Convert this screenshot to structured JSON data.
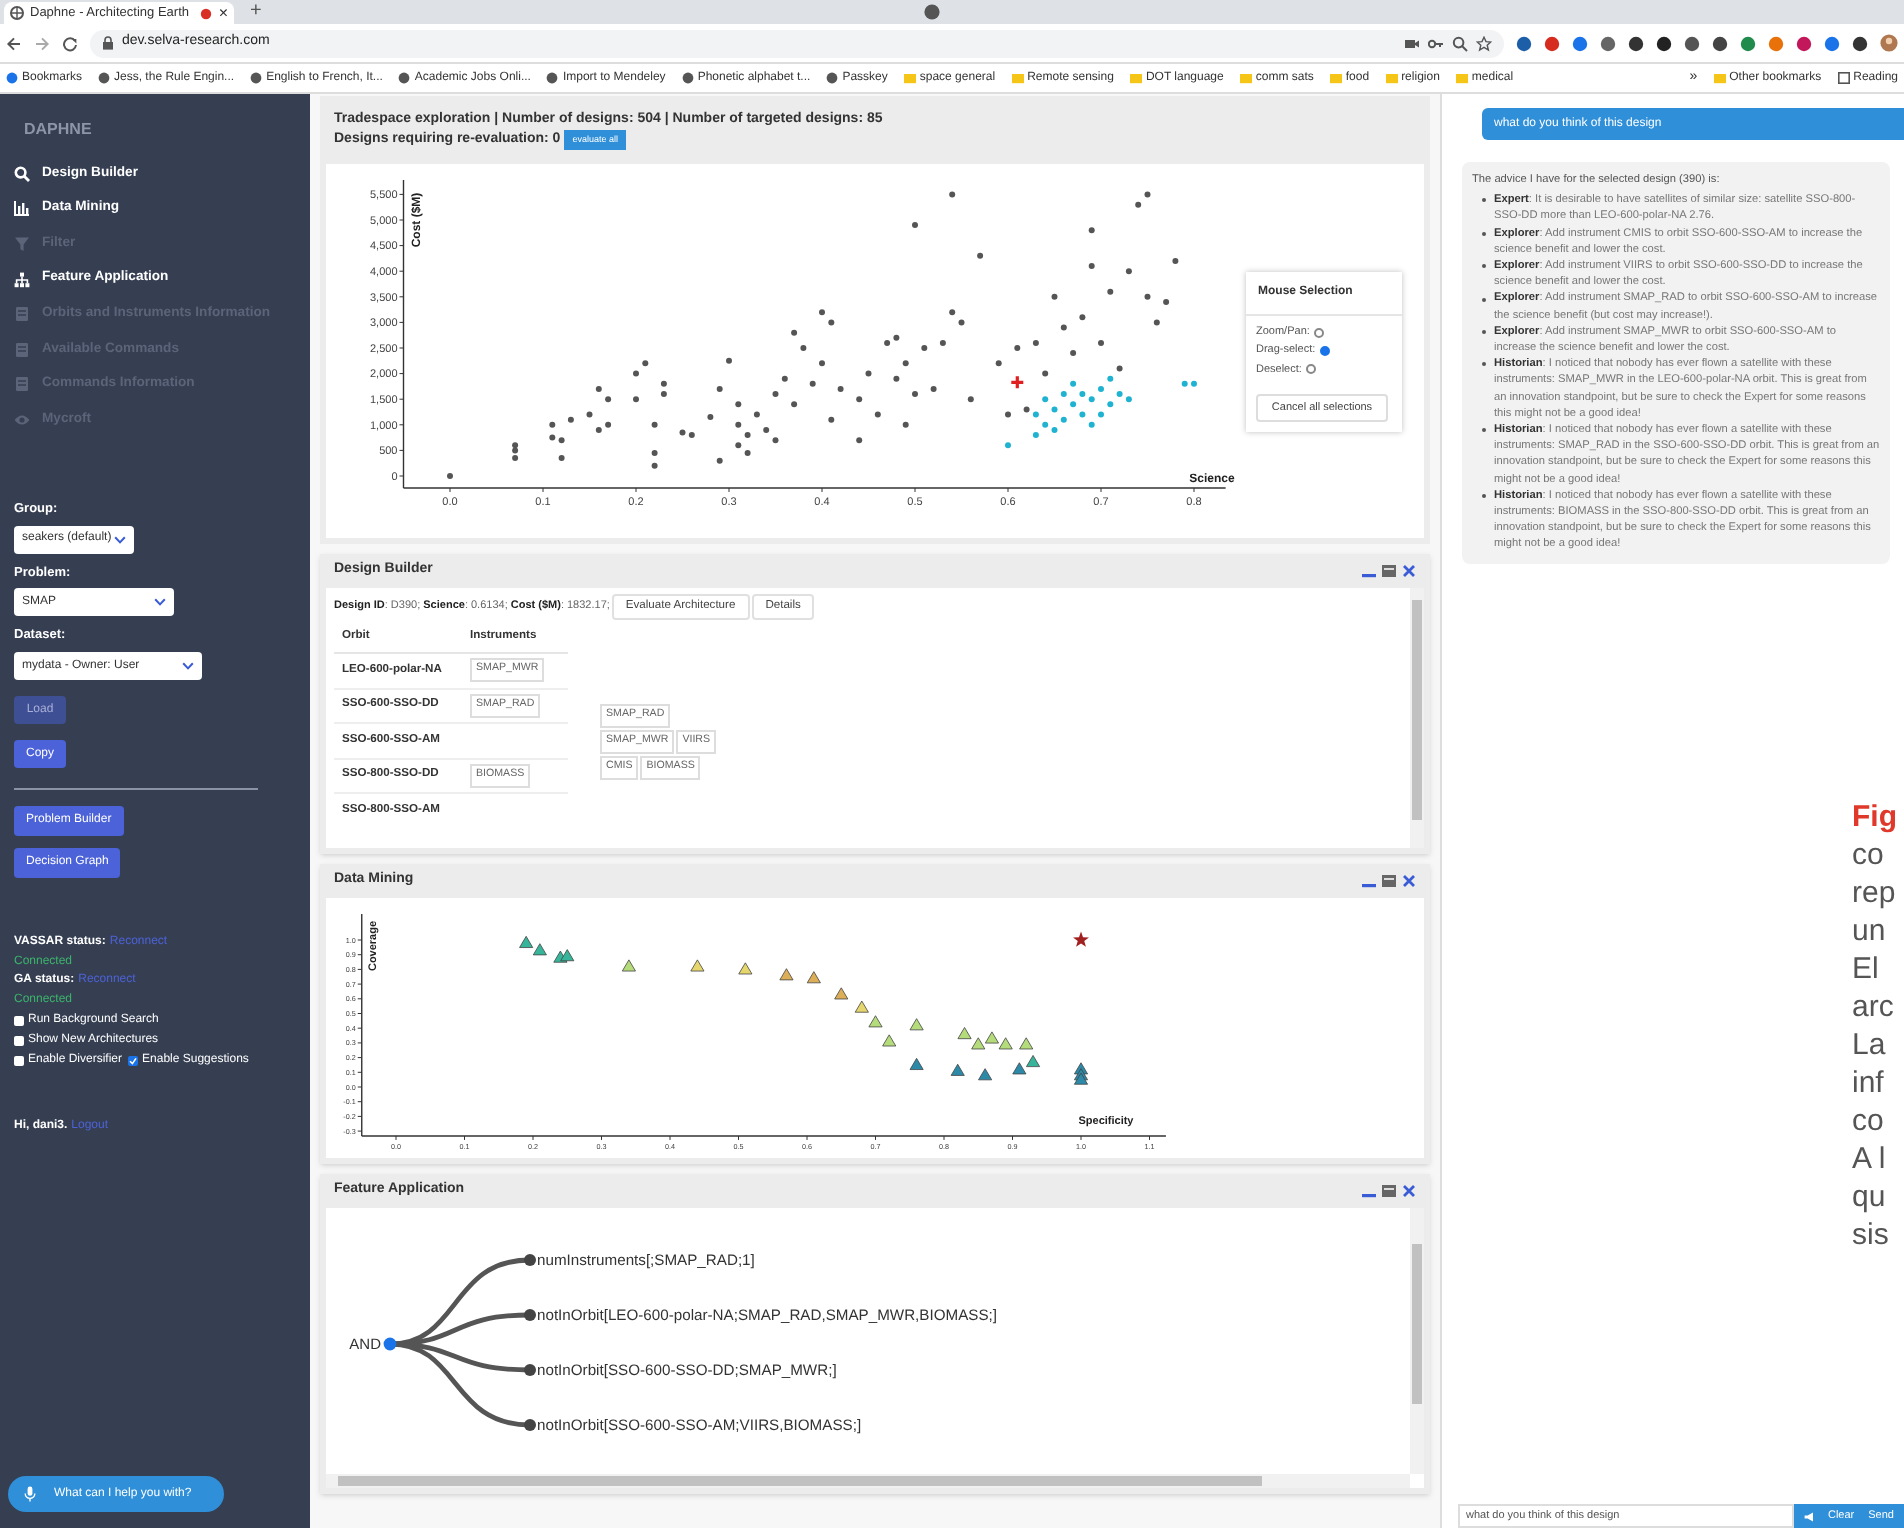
{
  "browser": {
    "tab": {
      "title": "Daphne - Architecting Earth",
      "recording": true,
      "close": "×"
    },
    "new_tab": "+",
    "address": "dev.selva-research.com",
    "bookmarks": [
      "Bookmarks",
      "Jess, the Rule Engin...",
      "English to French, It...",
      "Academic Jobs Onli...",
      "Import to Mendeley",
      "Phonetic alphabet t...",
      "Passkey",
      "space general",
      "Remote sensing",
      "DOT language",
      "comm sats",
      "food",
      "religion",
      "medical"
    ],
    "more": "»",
    "other_bookmarks": [
      "Other bookmarks",
      "Reading"
    ]
  },
  "sidebar": {
    "logo": "DAPHNE",
    "nav": [
      {
        "label": "Design Builder",
        "disabled": false
      },
      {
        "label": "Data Mining",
        "disabled": false
      },
      {
        "label": "Filter",
        "disabled": true
      },
      {
        "label": "Feature Application",
        "disabled": false
      },
      {
        "label": "Orbits and Instruments Information",
        "disabled": true
      },
      {
        "label": "Available Commands",
        "disabled": true
      },
      {
        "label": "Commands Information",
        "disabled": true
      },
      {
        "label": "Mycroft",
        "disabled": true
      }
    ],
    "selects": [
      {
        "label": "Group:",
        "value": "seakers (default)"
      },
      {
        "label": "Problem:",
        "value": "SMAP"
      },
      {
        "label": "Dataset:",
        "value": "mydata - Owner: User"
      }
    ],
    "buttons": [
      {
        "label": "Load",
        "disabled": true
      },
      {
        "label": "Copy",
        "disabled": false
      }
    ],
    "buttons_2": [
      "Problem Builder",
      "Decision Graph"
    ],
    "status": [
      {
        "label": "VASSAR status:",
        "action": "Reconnect",
        "state": "Connected"
      },
      {
        "label": "GA status:",
        "action": "Reconnect",
        "state": "Connected"
      }
    ],
    "options": [
      [
        {
          "label": "Run Background Search",
          "checked": false
        }
      ],
      [
        {
          "label": "Show New Architectures",
          "checked": false
        }
      ],
      [
        {
          "label": "Enable Diversifier",
          "checked": false
        },
        {
          "label": "Enable Suggestions",
          "checked": true
        }
      ]
    ],
    "greeting": "Hi, dani3.",
    "logout": "Logout",
    "assistant_button": "What can I help you with?"
  },
  "tradespace": {
    "title": "Tradespace exploration | Number of designs: 504 | Number of targeted designs: 85",
    "reevaluation": "Designs requiring re-evaluation: 0",
    "evaluate_button": "evaluate all",
    "chart_data": {
      "type": "scatter",
      "xlabel": "Science",
      "ylabel": "Cost ($M)",
      "xticks": [
        {
          "value": 0,
          "label": "0.0"
        },
        {
          "value": 0.1,
          "label": "0.1"
        },
        {
          "value": 0.2,
          "label": "0.2"
        },
        {
          "value": 0.3,
          "label": "0.3"
        },
        {
          "value": 0.4,
          "label": "0.4"
        },
        {
          "value": 0.5,
          "label": "0.5"
        },
        {
          "value": 0.6,
          "label": "0.6"
        },
        {
          "value": 0.7,
          "label": "0.7"
        },
        {
          "value": 0.8,
          "label": "0.8"
        }
      ],
      "yticks": [
        {
          "value": 0,
          "label": "0"
        },
        {
          "value": 500,
          "label": "500"
        },
        {
          "value": 1000,
          "label": "1,000"
        },
        {
          "value": 1500,
          "label": "1,500"
        },
        {
          "value": 2000,
          "label": "2,000"
        },
        {
          "value": 2500,
          "label": "2,500"
        },
        {
          "value": 3000,
          "label": "3,000"
        },
        {
          "value": 3500,
          "label": "3,500"
        },
        {
          "value": 4000,
          "label": "4,000"
        },
        {
          "value": 4500,
          "label": "4,500"
        },
        {
          "value": 5000,
          "label": "5,000"
        },
        {
          "value": 5500,
          "label": "5,500"
        }
      ],
      "xlim": [
        -0.05,
        0.834
      ],
      "ylim": [
        -234,
        5781
      ],
      "series": [
        {
          "color": "#555555",
          "marker": "dot",
          "x": [
            0.0,
            0.07,
            0.07,
            0.07,
            0.11,
            0.11,
            0.12,
            0.12,
            0.13,
            0.15,
            0.16,
            0.16,
            0.17,
            0.17,
            0.2,
            0.2,
            0.21,
            0.22,
            0.22,
            0.22,
            0.23,
            0.23,
            0.25,
            0.26,
            0.28,
            0.29,
            0.29,
            0.3,
            0.31,
            0.31,
            0.31,
            0.32,
            0.32,
            0.33,
            0.34,
            0.35,
            0.35,
            0.36,
            0.37,
            0.37,
            0.38,
            0.39,
            0.4,
            0.4,
            0.41,
            0.41,
            0.42,
            0.44,
            0.44,
            0.45,
            0.46,
            0.47,
            0.48,
            0.48,
            0.49,
            0.49,
            0.5,
            0.5,
            0.51,
            0.52,
            0.53,
            0.54,
            0.54,
            0.55,
            0.56,
            0.57,
            0.59,
            0.6,
            0.61,
            0.62,
            0.63,
            0.64,
            0.65,
            0.66,
            0.67,
            0.68,
            0.69,
            0.69,
            0.7,
            0.71,
            0.72,
            0.73,
            0.74,
            0.75,
            0.75,
            0.76,
            0.78,
            0.77
          ],
          "values": [
            0,
            600,
            350,
            500,
            1000,
            750,
            350,
            700,
            1100,
            1200,
            1700,
            900,
            1500,
            1000,
            2000,
            1500,
            2200,
            1000,
            200,
            450,
            1600,
            1800,
            850,
            800,
            1150,
            300,
            1700,
            2250,
            1400,
            600,
            1000,
            450,
            800,
            1200,
            900,
            1600,
            700,
            1900,
            2800,
            1400,
            2500,
            1800,
            3200,
            2200,
            3000,
            1100,
            1700,
            1500,
            700,
            2000,
            1200,
            2600,
            2700,
            1900,
            2200,
            1000,
            1600,
            4900,
            2500,
            1700,
            2600,
            5500,
            3200,
            3000,
            1500,
            4300,
            2200,
            1200,
            2500,
            1300,
            2600,
            2000,
            3500,
            2900,
            2400,
            3100,
            4800,
            4100,
            2600,
            3600,
            2100,
            4000,
            5300,
            5500,
            3500,
            3000,
            4200,
            3400
          ]
        },
        {
          "color": "#1fb3d1",
          "marker": "dot",
          "x": [
            0.6,
            0.63,
            0.63,
            0.64,
            0.65,
            0.65,
            0.66,
            0.66,
            0.67,
            0.67,
            0.68,
            0.68,
            0.69,
            0.69,
            0.7,
            0.71,
            0.71,
            0.72,
            0.73,
            0.79,
            0.8,
            0.64,
            0.7
          ],
          "values": [
            600,
            800,
            1200,
            1500,
            900,
            1300,
            1600,
            1100,
            1800,
            1400,
            1200,
            1600,
            1000,
            1500,
            1700,
            1900,
            1400,
            1600,
            1500,
            1800,
            1800,
            1000,
            1200
          ]
        },
        {
          "color": "#e02020",
          "marker": "cross",
          "x": [
            0.61
          ],
          "values": [
            1830
          ]
        }
      ]
    },
    "mouse_selection": {
      "title": "Mouse Selection",
      "modes": [
        {
          "label": "Zoom/Pan:",
          "selected": false
        },
        {
          "label": "Drag-select:",
          "selected": true
        },
        {
          "label": "Deselect:",
          "selected": false
        }
      ],
      "cancel_button": "Cancel all selections"
    }
  },
  "design_builder": {
    "title": "Design Builder",
    "summary": "**Design ID**: D390; **Science**: 0.6134; **Cost ($M)**: 1832.17;",
    "buttons": [
      "Evaluate Architecture",
      "Details"
    ],
    "columns": [
      "Orbit",
      "Instruments"
    ],
    "rows": [
      {
        "orbit": "LEO-600-polar-NA",
        "instruments": [
          "SMAP_MWR"
        ]
      },
      {
        "orbit": "SSO-600-SSO-DD",
        "instruments": [
          "SMAP_RAD"
        ]
      },
      {
        "orbit": "SSO-600-SSO-AM",
        "instruments": []
      },
      {
        "orbit": "SSO-800-SSO-DD",
        "instruments": [
          "BIOMASS"
        ]
      },
      {
        "orbit": "SSO-800-SSO-AM",
        "instruments": []
      }
    ],
    "pool": [
      [
        "SMAP_RAD"
      ],
      [
        "SMAP_MWR",
        "VIIRS"
      ],
      [
        "CMIS",
        "BIOMASS"
      ]
    ]
  },
  "data_mining": {
    "title": "Data Mining",
    "chart_data": {
      "type": "scatter",
      "xlabel": "Specificity",
      "ylabel": "Coverage",
      "xticks": [
        {
          "value": 0,
          "label": "0.0"
        },
        {
          "value": 0.1,
          "label": "0.1"
        },
        {
          "value": 0.2,
          "label": "0.2"
        },
        {
          "value": 0.3,
          "label": "0.3"
        },
        {
          "value": 0.4,
          "label": "0.4"
        },
        {
          "value": 0.5,
          "label": "0.5"
        },
        {
          "value": 0.6,
          "label": "0.6"
        },
        {
          "value": 0.7,
          "label": "0.7"
        },
        {
          "value": 0.8,
          "label": "0.8"
        },
        {
          "value": 0.9,
          "label": "0.9"
        },
        {
          "value": 1.0,
          "label": "1.0"
        },
        {
          "value": 1.1,
          "label": "1.1"
        }
      ],
      "yticks": [
        {
          "value": -0.3,
          "label": "-0.3"
        },
        {
          "value": -0.2,
          "label": "-0.2"
        },
        {
          "value": -0.1,
          "label": "-0.1"
        },
        {
          "value": 0,
          "label": "0.0"
        },
        {
          "value": 0.1,
          "label": "0.1"
        },
        {
          "value": 0.2,
          "label": "0.2"
        },
        {
          "value": 0.3,
          "label": "0.3"
        },
        {
          "value": 0.4,
          "label": "0.4"
        },
        {
          "value": 0.5,
          "label": "0.5"
        },
        {
          "value": 0.6,
          "label": "0.6"
        },
        {
          "value": 0.7,
          "label": "0.7"
        },
        {
          "value": 0.8,
          "label": "0.8"
        },
        {
          "value": 0.9,
          "label": "0.9"
        },
        {
          "value": 1.0,
          "label": "1.0"
        }
      ],
      "xlim": [
        -0.05,
        1.124
      ],
      "ylim": [
        -0.333,
        1.177
      ],
      "series": [
        {
          "color": "#37b59a",
          "marker": "triangle",
          "x": [
            0.19,
            0.21,
            0.24,
            0.25,
            0.93
          ],
          "values": [
            0.98,
            0.93,
            0.88,
            0.89,
            0.17
          ]
        },
        {
          "color": "#b5dc7a",
          "marker": "triangle",
          "x": [
            0.34,
            0.7,
            0.72,
            0.76,
            0.83,
            0.85,
            0.87,
            0.89,
            0.92
          ],
          "values": [
            0.82,
            0.44,
            0.31,
            0.42,
            0.36,
            0.29,
            0.33,
            0.29,
            0.29
          ]
        },
        {
          "color": "#e6d66e",
          "marker": "triangle",
          "x": [
            0.44,
            0.51,
            0.68
          ],
          "values": [
            0.82,
            0.8,
            0.54
          ]
        },
        {
          "color": "#dcae58",
          "marker": "triangle",
          "x": [
            0.57,
            0.61,
            0.65
          ],
          "values": [
            0.76,
            0.74,
            0.63
          ]
        },
        {
          "color": "#2c89a8",
          "marker": "triangle",
          "x": [
            0.76,
            0.82,
            0.86,
            0.91,
            1.0,
            1.0,
            1.0
          ],
          "values": [
            0.15,
            0.11,
            0.08,
            0.12,
            0.12,
            0.08,
            0.05
          ]
        },
        {
          "color": "#a2201f",
          "marker": "star",
          "x": [
            1.0
          ],
          "values": [
            1.0
          ]
        }
      ]
    }
  },
  "feature_application": {
    "title": "Feature Application",
    "root": "AND",
    "children": [
      "numInstruments[;SMAP_RAD;1]",
      "notInOrbit[LEO-600-polar-NA;SMAP_RAD,SMAP_MWR,BIOMASS;]",
      "notInOrbit[SSO-600-SSO-DD;SMAP_MWR;]",
      "notInOrbit[SSO-600-SSO-AM;VIIRS,BIOMASS;]"
    ]
  },
  "chat": {
    "user_message": "what do you think of this design",
    "intro": "The advice I have for the selected design (390) is:",
    "advice": [
      "**Expert**: It is desirable to have satellites of similar size: satellite SSO-800-SSO-DD more than LEO-600-polar-NA 2.76.",
      "**Explorer**: Add instrument CMIS to orbit SSO-600-SSO-AM to increase the science benefit and lower the cost.",
      "**Explorer**: Add instrument VIIRS to orbit SSO-600-SSO-DD to increase the science benefit and lower the cost.",
      "**Explorer**: Add instrument SMAP_RAD to orbit SSO-600-SSO-AM to increase the science benefit (but cost may increase!).",
      "**Explorer**: Add instrument SMAP_MWR to orbit SSO-600-SSO-AM to increase the science benefit and lower the cost.",
      "**Historian**: I noticed that nobody has ever flown a satellite with these instruments: SMAP_MWR in the LEO-600-polar-NA orbit. This is great from an innovation standpoint, but be sure to check the Expert for some reasons this might not be a good idea!",
      "**Historian**: I noticed that nobody has ever flown a satellite with these instruments: SMAP_RAD in the SSO-600-SSO-DD orbit. This is great from an innovation standpoint, but be sure to check the Expert for some reasons this might not be a good idea!",
      "**Historian**: I noticed that nobody has ever flown a satellite with these instruments: BIOMASS in the SSO-800-SSO-DD orbit. This is great from an innovation standpoint, but be sure to check the Expert for some reasons this might not be a good idea!"
    ],
    "input_value": "what do you think of this design",
    "buttons": [
      "Clear",
      "Send"
    ]
  },
  "caption_fragments": [
    "Fig",
    "co",
    "rep",
    "un",
    "El",
    "arc",
    "La",
    "inf",
    "co",
    "A l",
    "qu",
    "sis"
  ]
}
